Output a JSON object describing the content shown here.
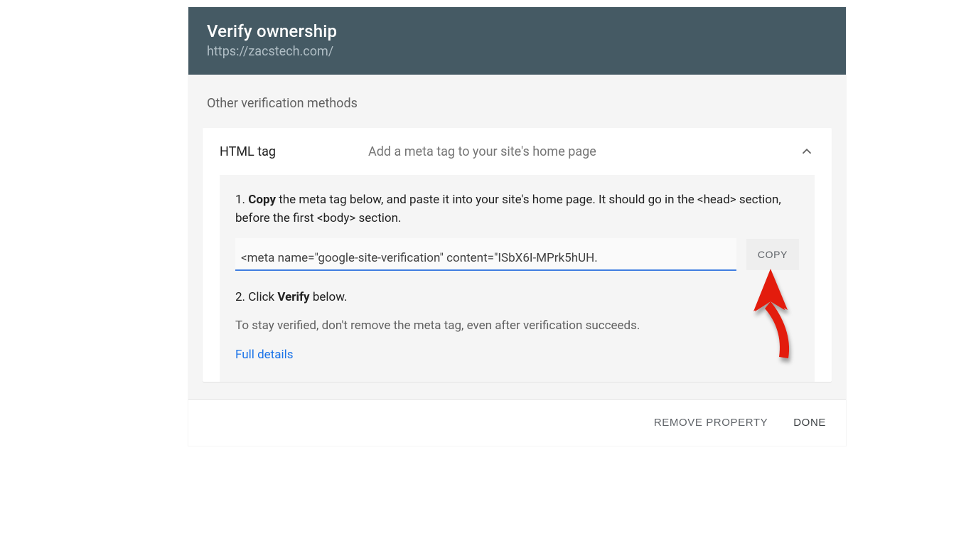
{
  "header": {
    "title": "Verify ownership",
    "subtitle": "https://zacstech.com/"
  },
  "body": {
    "section_label": "Other verification methods"
  },
  "method": {
    "name": "HTML tag",
    "description": "Add a meta tag to your site's home page",
    "step1_pre": "1. ",
    "step1_bold": "Copy",
    "step1_rest": " the meta tag below, and paste it into your site's home page. It should go in the <head> section, before the first <body> section.",
    "code_value": "<meta name=\"google-site-verification\" content=\"ISbX6I-MPrk5hUH.",
    "copy_label": "COPY",
    "step2_pre": "2. Click ",
    "step2_bold": "Verify",
    "step2_rest": " below.",
    "note": "To stay verified, don't remove the meta tag, even after verification succeeds.",
    "details_link": "Full details"
  },
  "footer": {
    "remove_label": "REMOVE PROPERTY",
    "done_label": "DONE"
  },
  "colors": {
    "header_bg": "#455a64",
    "accent": "#1a73e8",
    "underline": "#3f7de0",
    "annotation": "#e31b0c"
  }
}
